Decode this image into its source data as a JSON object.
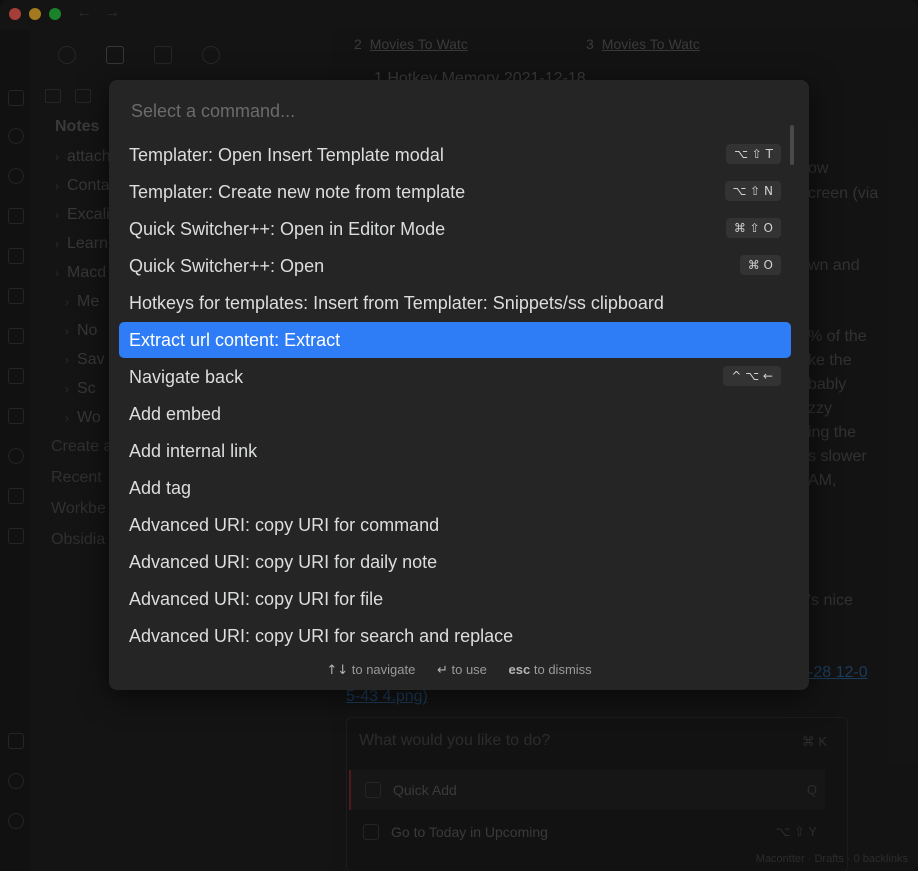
{
  "sidebar": {
    "heading": "Notes",
    "tree": [
      "attach",
      "Conta",
      "Excali",
      "Learn",
      "Macd",
      "Me",
      "No",
      "Sav",
      "Sc",
      "Wo"
    ],
    "links": [
      "Create a",
      "Recent",
      "Workbe",
      "Obsidia"
    ]
  },
  "editor": {
    "tabs": [
      {
        "num": "2",
        "name": "Movies To Watc"
      },
      {
        "num": "3",
        "name": "Movies To Watc"
      }
    ],
    "title": "1  Hotkey Memory 2021-12-18",
    "fragments": [
      "ow",
      "creen (via",
      "wn and",
      "% of the",
      "ke the",
      "bably",
      "zzy",
      "ing the",
      "s slower",
      "AM,",
      "'s nice"
    ],
    "link_fragments": [
      "-28 12-0",
      "5-43 4.png)"
    ]
  },
  "quick_add": {
    "placeholder": "What would you like to do?",
    "shortcut": "⌘ K",
    "items": [
      {
        "label": "Quick Add",
        "key": "Q"
      },
      {
        "label": "Go to Today in Upcoming",
        "key": "⌥ ⇧ Y"
      }
    ]
  },
  "status_bar": "Macontter · Drafts · 0 backlinks",
  "palette": {
    "placeholder": "Select a command...",
    "selected_index": 5,
    "commands": [
      {
        "label": "Templater: Open Insert Template modal",
        "shortcut": "⌥ ⇧ T"
      },
      {
        "label": "Templater: Create new note from template",
        "shortcut": "⌥ ⇧ N"
      },
      {
        "label": "Quick Switcher++: Open in Editor Mode",
        "shortcut": "⌘ ⇧ O"
      },
      {
        "label": "Quick Switcher++: Open",
        "shortcut": "⌘ O"
      },
      {
        "label": "Hotkeys for templates: Insert from Templater: Snippets/ss clipboard",
        "shortcut": ""
      },
      {
        "label": "Extract url content: Extract",
        "shortcut": ""
      },
      {
        "label": "Navigate back",
        "shortcut": "^ ⌥ ←"
      },
      {
        "label": "Add embed",
        "shortcut": ""
      },
      {
        "label": "Add internal link",
        "shortcut": ""
      },
      {
        "label": "Add tag",
        "shortcut": ""
      },
      {
        "label": "Advanced URI: copy URI for command",
        "shortcut": ""
      },
      {
        "label": "Advanced URI: copy URI for daily note",
        "shortcut": ""
      },
      {
        "label": "Advanced URI: copy URI for file",
        "shortcut": ""
      },
      {
        "label": "Advanced URI: copy URI for search and replace",
        "shortcut": ""
      }
    ],
    "footer": {
      "navigate_key": "↑↓",
      "navigate_label": "to navigate",
      "use_key": "↵",
      "use_label": "to use",
      "dismiss_key": "esc",
      "dismiss_label": "to dismiss"
    }
  },
  "colors": {
    "accent": "#2e7cf6",
    "palette_bg": "#252525"
  }
}
